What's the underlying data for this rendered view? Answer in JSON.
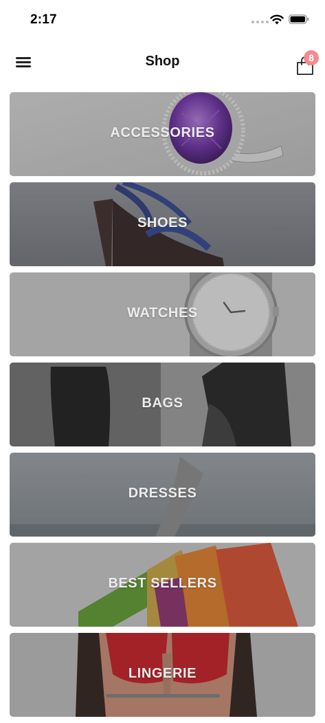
{
  "status_bar": {
    "time": "2:17"
  },
  "nav": {
    "title": "Shop",
    "menu_icon": "hamburger-menu-icon",
    "cart_icon": "shopping-bag-icon",
    "cart_count": "8",
    "badge_color": "#f48a8f"
  },
  "categories": [
    {
      "label": "ACCESSORIES",
      "image": "amethyst-ring"
    },
    {
      "label": "SHOES",
      "image": "strappy-high-heel"
    },
    {
      "label": "WATCHES",
      "image": "tiffany-watch"
    },
    {
      "label": "BAGS",
      "image": "black-backpacks"
    },
    {
      "label": "DRESSES",
      "image": "figure-by-sea"
    },
    {
      "label": "BEST SELLERS",
      "image": "shopping-bags"
    },
    {
      "label": "LINGERIE",
      "image": "red-lace-lingerie"
    }
  ]
}
